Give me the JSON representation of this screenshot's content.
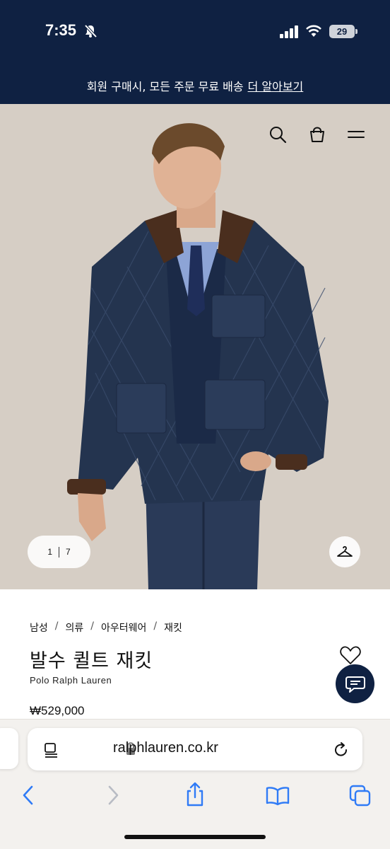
{
  "status_bar": {
    "time": "7:35",
    "battery": "29"
  },
  "promo": {
    "text": "회원 구매시, 모든 주문 무료 배송",
    "link": "더 알아보기"
  },
  "header_icons": [
    "search-icon",
    "bag-icon",
    "menu-icon"
  ],
  "gallery": {
    "current": "1",
    "total": "7"
  },
  "breadcrumb": {
    "items": [
      "남성",
      "의류",
      "아우터웨어",
      "재킷"
    ],
    "separator": "/"
  },
  "product": {
    "title": "발수 퀼트 재킷",
    "brand": "Polo Ralph Lauren",
    "price": "₩529,000"
  },
  "browser": {
    "url": "ralphlauren.co.kr"
  },
  "colors": {
    "navy": "#0f2142",
    "accent_blue": "#2f7bf6",
    "hero_bg": "#d6cec5"
  }
}
